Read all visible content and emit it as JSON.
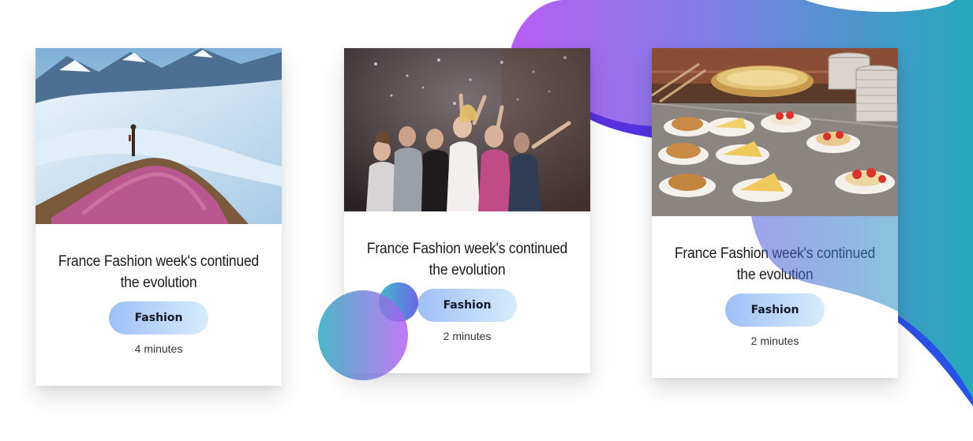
{
  "cards": [
    {
      "image": "mountain-glacier-photo",
      "title": "France Fashion week's continued the evolution",
      "tag": "Fashion",
      "read_time": "4 minutes"
    },
    {
      "image": "party-confetti-photo",
      "title": "France Fashion week's continued the evolution",
      "tag": "Fashion",
      "read_time": "2 minutes"
    },
    {
      "image": "pastry-buffet-photo",
      "title": "France Fashion week's continued the evolution",
      "tag": "Fashion",
      "read_time": "2 minutes"
    }
  ],
  "colors": {
    "blob_purple": "#b565f4",
    "blob_teal": "#2aa6bd",
    "blob_blue": "#3d4fd9",
    "tag_gradient_start": "#9fc0f7",
    "tag_gradient_end": "#d6ebfb"
  }
}
